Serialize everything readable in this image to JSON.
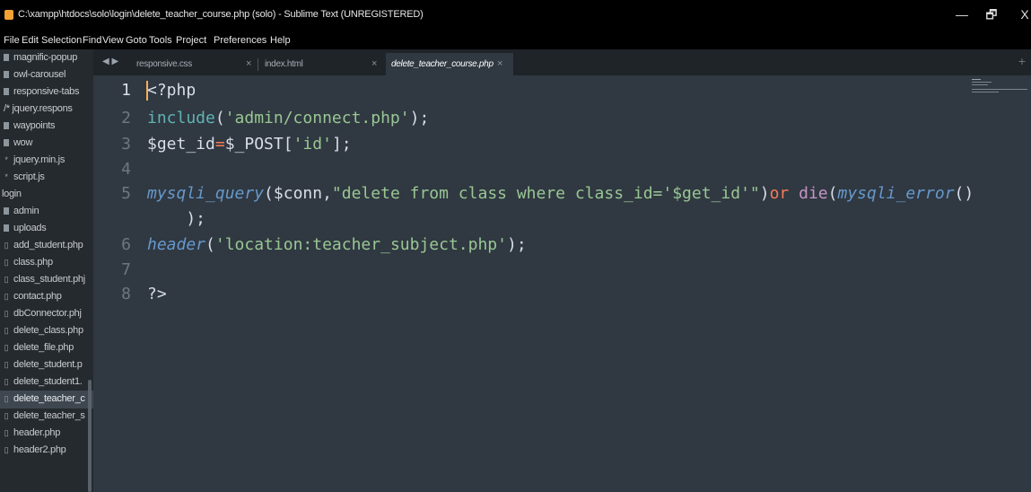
{
  "window": {
    "title": "C:\\xampp\\htdocs\\solo\\login\\delete_teacher_course.php (solo) - Sublime Text (UNREGISTERED)",
    "minimize": "—",
    "maximize": "🗗",
    "close": "X"
  },
  "menu": [
    "File",
    "Edit",
    "Selection",
    "Find",
    "View",
    "Goto",
    "Tools",
    "Project",
    "Preferences",
    "Help"
  ],
  "sidebar": {
    "items": [
      {
        "label": "magnific-popup",
        "icon": "folder-icon"
      },
      {
        "label": "owl-carousel",
        "icon": "folder-icon"
      },
      {
        "label": "responsive-tabs",
        "icon": "folder-icon"
      },
      {
        "label": "/* jquery.respons",
        "icon": "none"
      },
      {
        "label": "waypoints",
        "icon": "folder-icon"
      },
      {
        "label": "wow",
        "icon": "folder-icon"
      },
      {
        "label": "jquery.min.js",
        "icon": "file-icon"
      },
      {
        "label": "script.js",
        "icon": "file-icon"
      },
      {
        "label": "login",
        "icon": "none"
      },
      {
        "label": "admin",
        "icon": "folder-icon"
      },
      {
        "label": "uploads",
        "icon": "folder-icon"
      },
      {
        "label": "add_student.php",
        "icon": "file-icon"
      },
      {
        "label": "class.php",
        "icon": "file-icon"
      },
      {
        "label": "class_student.phj",
        "icon": "file-icon"
      },
      {
        "label": "contact.php",
        "icon": "file-icon"
      },
      {
        "label": "dbConnector.phj",
        "icon": "file-icon"
      },
      {
        "label": "delete_class.php",
        "icon": "file-icon"
      },
      {
        "label": "delete_file.php",
        "icon": "file-icon"
      },
      {
        "label": "delete_student.p",
        "icon": "file-icon"
      },
      {
        "label": "delete_student1.",
        "icon": "file-icon"
      },
      {
        "label": "delete_teacher_c",
        "icon": "file-icon",
        "selected": true
      },
      {
        "label": "delete_teacher_s",
        "icon": "file-icon"
      },
      {
        "label": "header.php",
        "icon": "file-icon"
      },
      {
        "label": "header2.php",
        "icon": "file-icon"
      }
    ]
  },
  "tabs": [
    {
      "label": "responsive.css",
      "close": "×"
    },
    {
      "label": "index.html",
      "close": "×"
    },
    {
      "label": "delete_teacher_course.php",
      "close": "×",
      "active": true
    }
  ],
  "tab_nav": "◀ ▶",
  "tab_add": "+",
  "editor": {
    "line_numbers": [
      "1",
      "2",
      "3",
      "4",
      "5",
      "",
      "6",
      "7",
      "8"
    ],
    "code": {
      "l1": "<?php",
      "l2_fn": "include",
      "l2_open": "(",
      "l2_str": "'admin/connect.php'",
      "l2_close": ");",
      "l3_var": "$get_id",
      "l3_eq": "=",
      "l3_post": "$_POST",
      "l3_br": "[",
      "l3_str": "'id'",
      "l3_end": "];",
      "l5_fn": "mysqli_query",
      "l5_open": "(",
      "l5_conn": "$conn",
      "l5_comma": ",",
      "l5_str": "\"delete from class where class_id='$get_id'\"",
      "l5_close": ")",
      "l5_or": "or",
      "l5_die": " die",
      "l5_open2": "(",
      "l5_err": "mysqli_error",
      "l5_end": "()",
      "l5b": "    );",
      "l6_fn": "header",
      "l6_open": "(",
      "l6_str": "'location:teacher_subject.php'",
      "l6_close": ");",
      "l8": "?>"
    }
  }
}
